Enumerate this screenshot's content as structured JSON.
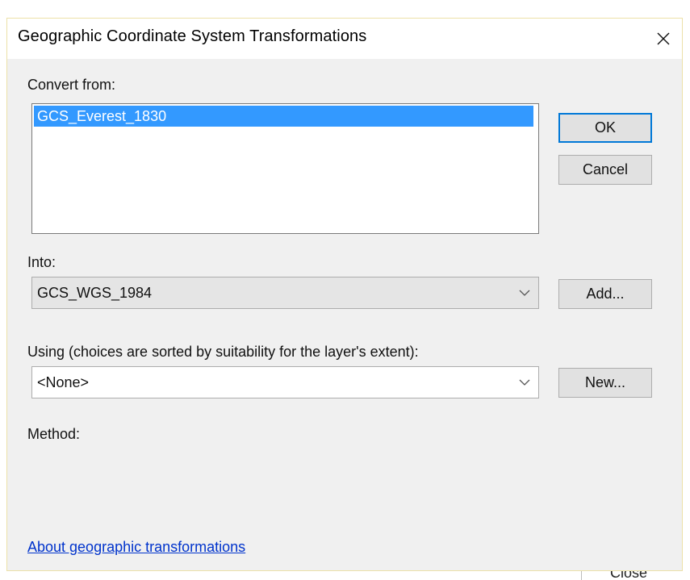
{
  "dialog": {
    "title": "Geographic Coordinate System Transformations",
    "close_icon": "close-icon"
  },
  "convert_from": {
    "label": "Convert from:",
    "items": [
      "GCS_Everest_1830"
    ],
    "selected_index": 0
  },
  "into": {
    "label": "Into:",
    "value": "GCS_WGS_1984"
  },
  "using": {
    "label": "Using (choices are sorted by suitability for the layer's extent):",
    "value": "<None>"
  },
  "method": {
    "label": "Method:"
  },
  "buttons": {
    "ok": "OK",
    "cancel": "Cancel",
    "add": "Add...",
    "new": "New..."
  },
  "link": {
    "text": "About geographic transformations"
  },
  "background": {
    "partial_button_text": "Close"
  },
  "colors": {
    "selection": "#3399ff",
    "default_button_border": "#0078d7",
    "link": "#0033cc",
    "dialog_bg": "#f0f0f0"
  }
}
